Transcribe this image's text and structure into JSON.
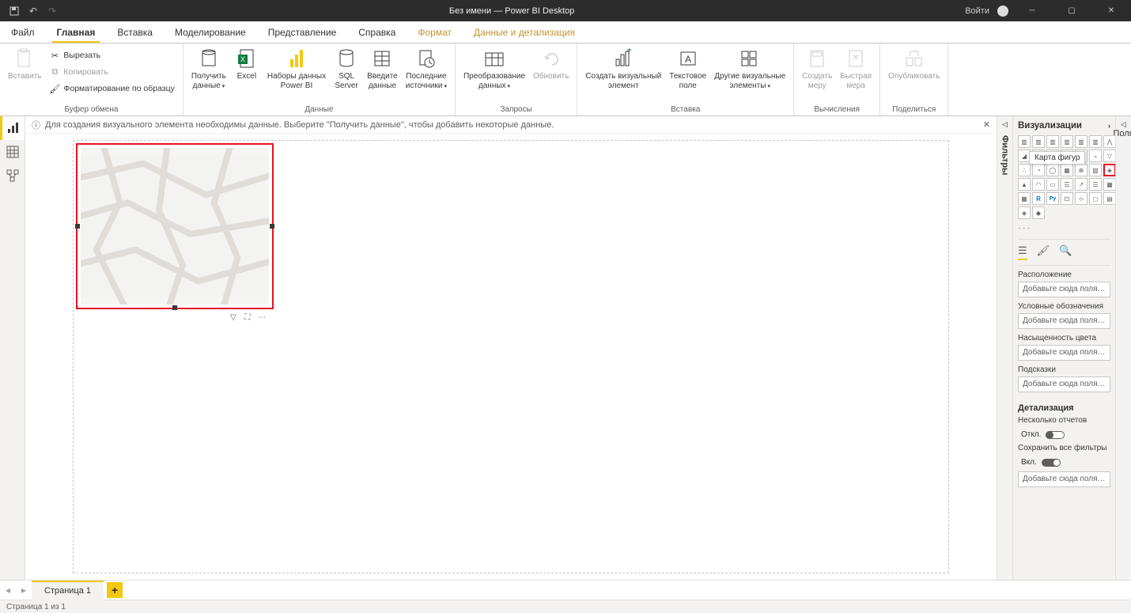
{
  "titlebar": {
    "title": "Без имени — Power BI Desktop",
    "signin": "Войти"
  },
  "tabs": {
    "file": "Файл",
    "items": [
      "Главная",
      "Вставка",
      "Моделирование",
      "Представление",
      "Справка"
    ],
    "context": [
      "Формат",
      "Данные и детализация"
    ]
  },
  "ribbon": {
    "clipboard": {
      "paste": "Вставить",
      "cut": "Вырезать",
      "copy": "Копировать",
      "formatpainter": "Форматирование по образцу",
      "label": "Буфер обмена"
    },
    "data": {
      "getdata": "Получить\nданные",
      "excel": "Excel",
      "pbidatasets": "Наборы данных\nPower BI",
      "sqlserver": "SQL\nServer",
      "enterdata": "Введите\nданные",
      "recentsources": "Последние\nисточники",
      "label": "Данные"
    },
    "queries": {
      "transform": "Преобразование\nданных",
      "refresh": "Обновить",
      "label": "Запросы"
    },
    "insert": {
      "newvisual": "Создать визуальный\nэлемент",
      "textbox": "Текстовое\nполе",
      "morevisuals": "Другие визуальные\nэлементы",
      "label": "Вставка"
    },
    "calc": {
      "newmeasure": "Создать\nмеру",
      "quickmeasure": "Быстрая\nмера",
      "label": "Вычисления"
    },
    "share": {
      "publish": "Опубликовать",
      "label": "Поделиться"
    }
  },
  "msgbar": {
    "text": "Для создания визуального элемента необходимы данные. Выберите \"Получить данные\", чтобы добавить некоторые данные."
  },
  "panes": {
    "filters": "Фильтры",
    "viz": "Визуализации",
    "fields_tab": "Поля",
    "tooltip": "Карта фигур"
  },
  "fieldwells": {
    "location": "Расположение",
    "legend": "Условные обозначения",
    "saturation": "Насыщенность цвета",
    "tooltips": "Подсказки",
    "placeholder": "Добавьте сюда поля с дан..."
  },
  "drill": {
    "title": "Детализация",
    "crossreport": "Несколько отчетов",
    "off": "Откл.",
    "keepfilters": "Сохранить все фильтры",
    "on": "Вкл.",
    "placeholder": "Добавьте сюда поля дета..."
  },
  "pagetabs": {
    "page1": "Страница 1"
  },
  "status": {
    "text": "Страница 1 из 1"
  }
}
